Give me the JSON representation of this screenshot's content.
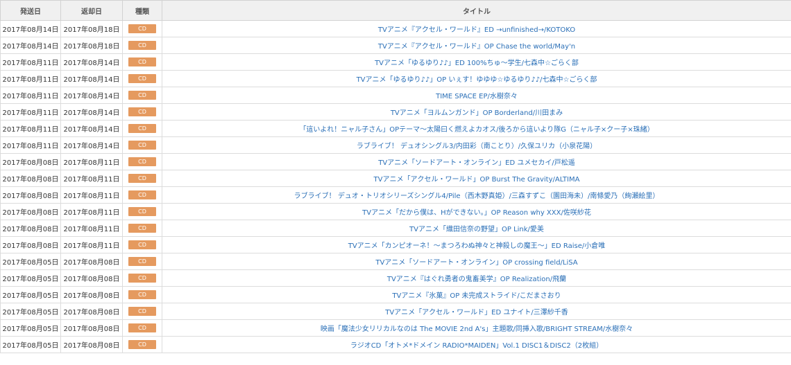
{
  "headers": {
    "send": "発送日",
    "return": "返却日",
    "kind": "種類",
    "title": "タイトル"
  },
  "rows": [
    {
      "send": "2017年08月14日",
      "return": "2017年08月18日",
      "kind": "CD",
      "title": "TVアニメ『アクセル・ワールド』ED →unfinished→/KOTOKO"
    },
    {
      "send": "2017年08月14日",
      "return": "2017年08月18日",
      "kind": "CD",
      "title": "TVアニメ『アクセル・ワールド』OP Chase the world/May'n"
    },
    {
      "send": "2017年08月11日",
      "return": "2017年08月14日",
      "kind": "CD",
      "title": "TVアニメ「ゆるゆり♪♪」ED 100%ちゅ〜学生/七森中☆ごらく部"
    },
    {
      "send": "2017年08月11日",
      "return": "2017年08月14日",
      "kind": "CD",
      "title": "TVアニメ「ゆるゆり♪♪」OP いぇす！ゆゆゆ☆ゆるゆり♪♪/七森中☆ごらく部"
    },
    {
      "send": "2017年08月11日",
      "return": "2017年08月14日",
      "kind": "CD",
      "title": "TIME SPACE EP/水樹奈々"
    },
    {
      "send": "2017年08月11日",
      "return": "2017年08月14日",
      "kind": "CD",
      "title": "TVアニメ「ヨルムンガンド」OP Borderland/川田まみ"
    },
    {
      "send": "2017年08月11日",
      "return": "2017年08月14日",
      "kind": "CD",
      "title": "「這いよれ！ニャル子さん」OPテーマ〜太陽曰く燃えよカオス/後ろから這いより隊G（ニャル子×クー子×珠緒）"
    },
    {
      "send": "2017年08月11日",
      "return": "2017年08月14日",
      "kind": "CD",
      "title": "ラブライブ！ デュオシングル3/内田彩（南ことり）/久保ユリカ（小泉花陽）"
    },
    {
      "send": "2017年08月08日",
      "return": "2017年08月11日",
      "kind": "CD",
      "title": "TVアニメ「ソードアート・オンライン」ED ユメセカイ/戸松遥"
    },
    {
      "send": "2017年08月08日",
      "return": "2017年08月11日",
      "kind": "CD",
      "title": "TVアニメ「アクセル・ワールド」OP Burst The Gravity/ALTIMA"
    },
    {
      "send": "2017年08月08日",
      "return": "2017年08月11日",
      "kind": "CD",
      "title": "ラブライブ！ デュオ・トリオシリーズシングル4/Pile（西木野真姫）/三森すずこ（園田海未）/南條愛乃（絢瀬絵里）"
    },
    {
      "send": "2017年08月08日",
      "return": "2017年08月11日",
      "kind": "CD",
      "title": "TVアニメ「だから僕は、Hができない。」OP Reason why XXX/佐咲紗花"
    },
    {
      "send": "2017年08月08日",
      "return": "2017年08月11日",
      "kind": "CD",
      "title": "TVアニメ「織田信奈の野望」OP Link/愛美"
    },
    {
      "send": "2017年08月08日",
      "return": "2017年08月11日",
      "kind": "CD",
      "title": "TVアニメ「カンピオーネ！〜まつろわぬ神々と神殺しの魔王〜」ED Raise/小倉唯"
    },
    {
      "send": "2017年08月05日",
      "return": "2017年08月08日",
      "kind": "CD",
      "title": "TVアニメ「ソードアート・オンライン」OP crossing field/LiSA"
    },
    {
      "send": "2017年08月05日",
      "return": "2017年08月08日",
      "kind": "CD",
      "title": "TVアニメ『はぐれ勇者の鬼畜美学』OP Realization/飛蘭"
    },
    {
      "send": "2017年08月05日",
      "return": "2017年08月08日",
      "kind": "CD",
      "title": "TVアニメ『氷菓』OP 未完成ストライド/こだまさおり"
    },
    {
      "send": "2017年08月05日",
      "return": "2017年08月08日",
      "kind": "CD",
      "title": "TVアニメ「アクセル・ワールド」ED ユナイト/三澤紗千香"
    },
    {
      "send": "2017年08月05日",
      "return": "2017年08月08日",
      "kind": "CD",
      "title": "映画「魔法少女リリカルなのは The MOVIE 2nd A's」主題歌/同挿入歌/BRIGHT STREAM/水樹奈々"
    },
    {
      "send": "2017年08月05日",
      "return": "2017年08月08日",
      "kind": "CD",
      "title": "ラジオCD「オトメ*ドメイン RADIO*MAIDEN」Vol.1 DISC1＆DISC2（2枚組）"
    }
  ]
}
